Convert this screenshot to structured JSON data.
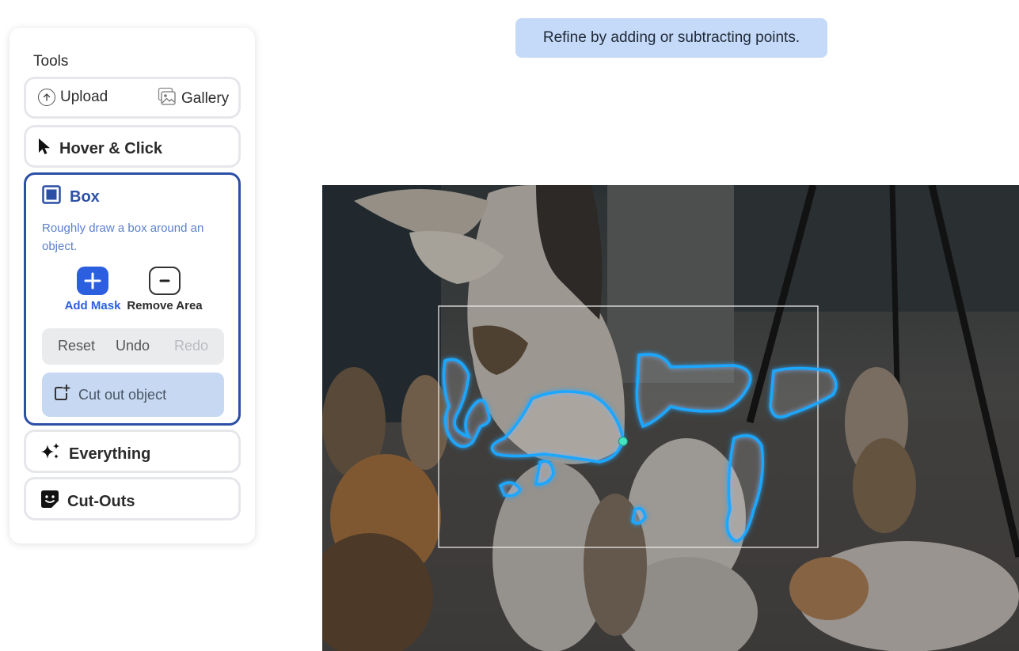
{
  "tools": {
    "title": "Tools",
    "upload_label": "Upload",
    "gallery_label": "Gallery",
    "hover_click_label": "Hover & Click",
    "box": {
      "title": "Box",
      "description": "Roughly draw a box around an object.",
      "add_mask_label": "Add Mask",
      "remove_area_label": "Remove Area",
      "reset_label": "Reset",
      "undo_label": "Undo",
      "redo_label": "Redo",
      "cut_out_label": "Cut out object"
    },
    "everything_label": "Everything",
    "cutouts_label": "Cut-Outs"
  },
  "banner": {
    "text": "Refine by adding or subtracting points."
  },
  "colors": {
    "accent": "#2c4fa6",
    "add_button": "#2c5fe0",
    "banner_bg": "#c5daf8",
    "mask_outline": "#1ba7ff",
    "point_marker": "#43e5c0"
  }
}
